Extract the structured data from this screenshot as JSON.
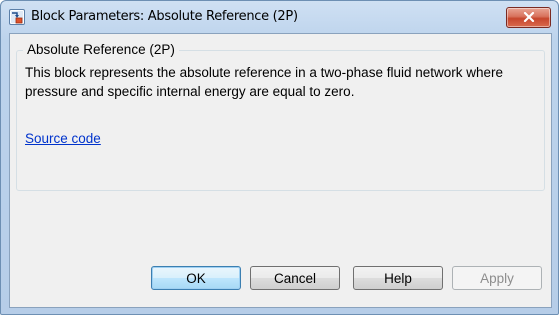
{
  "window": {
    "title": "Block Parameters: Absolute Reference (2P)",
    "close_icon": "close-icon"
  },
  "panel": {
    "group_title": "Absolute Reference (2P)",
    "description": "This block represents the absolute reference in a two-phase fluid network where pressure and specific internal energy are equal to zero.",
    "link_label": "Source code"
  },
  "buttons": {
    "ok": "OK",
    "cancel": "Cancel",
    "help": "Help",
    "apply": "Apply"
  },
  "colors": {
    "close_button": "#c7462d",
    "link": "#0033cc",
    "default_button_border": "#3c7fb1"
  }
}
